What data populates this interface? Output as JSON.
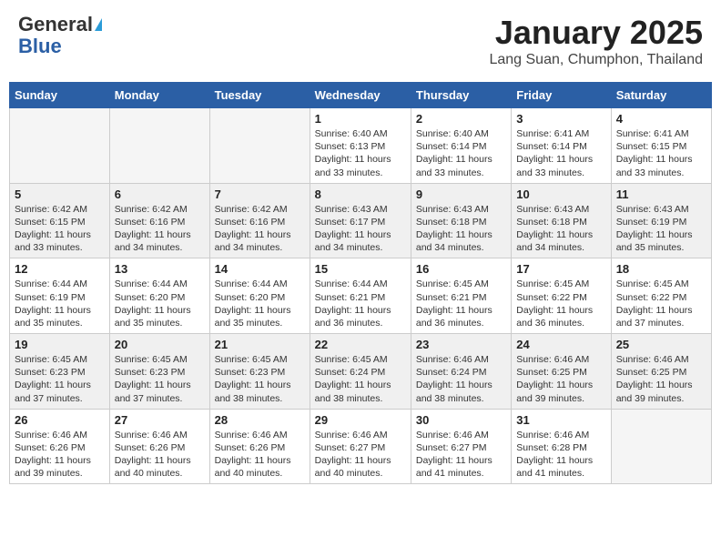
{
  "header": {
    "logo_general": "General",
    "logo_blue": "Blue",
    "month": "January 2025",
    "location": "Lang Suan, Chumphon, Thailand"
  },
  "weekdays": [
    "Sunday",
    "Monday",
    "Tuesday",
    "Wednesday",
    "Thursday",
    "Friday",
    "Saturday"
  ],
  "weeks": [
    [
      {
        "day": null,
        "info": null
      },
      {
        "day": null,
        "info": null
      },
      {
        "day": null,
        "info": null
      },
      {
        "day": "1",
        "info": "Sunrise: 6:40 AM\nSunset: 6:13 PM\nDaylight: 11 hours\nand 33 minutes."
      },
      {
        "day": "2",
        "info": "Sunrise: 6:40 AM\nSunset: 6:14 PM\nDaylight: 11 hours\nand 33 minutes."
      },
      {
        "day": "3",
        "info": "Sunrise: 6:41 AM\nSunset: 6:14 PM\nDaylight: 11 hours\nand 33 minutes."
      },
      {
        "day": "4",
        "info": "Sunrise: 6:41 AM\nSunset: 6:15 PM\nDaylight: 11 hours\nand 33 minutes."
      }
    ],
    [
      {
        "day": "5",
        "info": "Sunrise: 6:42 AM\nSunset: 6:15 PM\nDaylight: 11 hours\nand 33 minutes."
      },
      {
        "day": "6",
        "info": "Sunrise: 6:42 AM\nSunset: 6:16 PM\nDaylight: 11 hours\nand 34 minutes."
      },
      {
        "day": "7",
        "info": "Sunrise: 6:42 AM\nSunset: 6:16 PM\nDaylight: 11 hours\nand 34 minutes."
      },
      {
        "day": "8",
        "info": "Sunrise: 6:43 AM\nSunset: 6:17 PM\nDaylight: 11 hours\nand 34 minutes."
      },
      {
        "day": "9",
        "info": "Sunrise: 6:43 AM\nSunset: 6:18 PM\nDaylight: 11 hours\nand 34 minutes."
      },
      {
        "day": "10",
        "info": "Sunrise: 6:43 AM\nSunset: 6:18 PM\nDaylight: 11 hours\nand 34 minutes."
      },
      {
        "day": "11",
        "info": "Sunrise: 6:43 AM\nSunset: 6:19 PM\nDaylight: 11 hours\nand 35 minutes."
      }
    ],
    [
      {
        "day": "12",
        "info": "Sunrise: 6:44 AM\nSunset: 6:19 PM\nDaylight: 11 hours\nand 35 minutes."
      },
      {
        "day": "13",
        "info": "Sunrise: 6:44 AM\nSunset: 6:20 PM\nDaylight: 11 hours\nand 35 minutes."
      },
      {
        "day": "14",
        "info": "Sunrise: 6:44 AM\nSunset: 6:20 PM\nDaylight: 11 hours\nand 35 minutes."
      },
      {
        "day": "15",
        "info": "Sunrise: 6:44 AM\nSunset: 6:21 PM\nDaylight: 11 hours\nand 36 minutes."
      },
      {
        "day": "16",
        "info": "Sunrise: 6:45 AM\nSunset: 6:21 PM\nDaylight: 11 hours\nand 36 minutes."
      },
      {
        "day": "17",
        "info": "Sunrise: 6:45 AM\nSunset: 6:22 PM\nDaylight: 11 hours\nand 36 minutes."
      },
      {
        "day": "18",
        "info": "Sunrise: 6:45 AM\nSunset: 6:22 PM\nDaylight: 11 hours\nand 37 minutes."
      }
    ],
    [
      {
        "day": "19",
        "info": "Sunrise: 6:45 AM\nSunset: 6:23 PM\nDaylight: 11 hours\nand 37 minutes."
      },
      {
        "day": "20",
        "info": "Sunrise: 6:45 AM\nSunset: 6:23 PM\nDaylight: 11 hours\nand 37 minutes."
      },
      {
        "day": "21",
        "info": "Sunrise: 6:45 AM\nSunset: 6:23 PM\nDaylight: 11 hours\nand 38 minutes."
      },
      {
        "day": "22",
        "info": "Sunrise: 6:45 AM\nSunset: 6:24 PM\nDaylight: 11 hours\nand 38 minutes."
      },
      {
        "day": "23",
        "info": "Sunrise: 6:46 AM\nSunset: 6:24 PM\nDaylight: 11 hours\nand 38 minutes."
      },
      {
        "day": "24",
        "info": "Sunrise: 6:46 AM\nSunset: 6:25 PM\nDaylight: 11 hours\nand 39 minutes."
      },
      {
        "day": "25",
        "info": "Sunrise: 6:46 AM\nSunset: 6:25 PM\nDaylight: 11 hours\nand 39 minutes."
      }
    ],
    [
      {
        "day": "26",
        "info": "Sunrise: 6:46 AM\nSunset: 6:26 PM\nDaylight: 11 hours\nand 39 minutes."
      },
      {
        "day": "27",
        "info": "Sunrise: 6:46 AM\nSunset: 6:26 PM\nDaylight: 11 hours\nand 40 minutes."
      },
      {
        "day": "28",
        "info": "Sunrise: 6:46 AM\nSunset: 6:26 PM\nDaylight: 11 hours\nand 40 minutes."
      },
      {
        "day": "29",
        "info": "Sunrise: 6:46 AM\nSunset: 6:27 PM\nDaylight: 11 hours\nand 40 minutes."
      },
      {
        "day": "30",
        "info": "Sunrise: 6:46 AM\nSunset: 6:27 PM\nDaylight: 11 hours\nand 41 minutes."
      },
      {
        "day": "31",
        "info": "Sunrise: 6:46 AM\nSunset: 6:28 PM\nDaylight: 11 hours\nand 41 minutes."
      },
      {
        "day": null,
        "info": null
      }
    ]
  ]
}
